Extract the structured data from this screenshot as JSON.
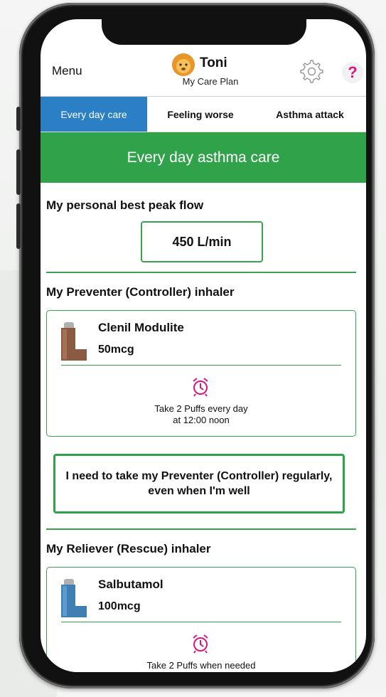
{
  "header": {
    "menu_label": "Menu",
    "user_name": "Toni",
    "subtitle": "My Care Plan",
    "help_label": "?"
  },
  "tabs": [
    {
      "label": "Every day care",
      "active": true
    },
    {
      "label": "Feeling worse",
      "active": false
    },
    {
      "label": "Asthma attack",
      "active": false
    }
  ],
  "banner": {
    "title": "Every day asthma care"
  },
  "peak_flow": {
    "title": "My personal best peak flow",
    "value": "450 L/min"
  },
  "preventer": {
    "title": "My Preventer (Controller) inhaler",
    "name": "Clenil Modulite",
    "dose": "50mcg",
    "instruction_line1": "Take 2 Puffs every day",
    "instruction_line2": "at 12:00 noon",
    "color": "#8a5a43"
  },
  "reminder": {
    "text": "I need to take my Preventer (Controller) regularly, even when I'm well"
  },
  "reliever": {
    "title": "My Reliever (Rescue) inhaler",
    "name": "Salbutamol",
    "dose": "100mcg",
    "instruction_line1": "Take 2 Puffs when needed",
    "color": "#3f7fb3"
  },
  "colors": {
    "accent_green": "#2fa24a",
    "tab_active": "#2b7fc5",
    "alarm_pink": "#d8167e"
  }
}
